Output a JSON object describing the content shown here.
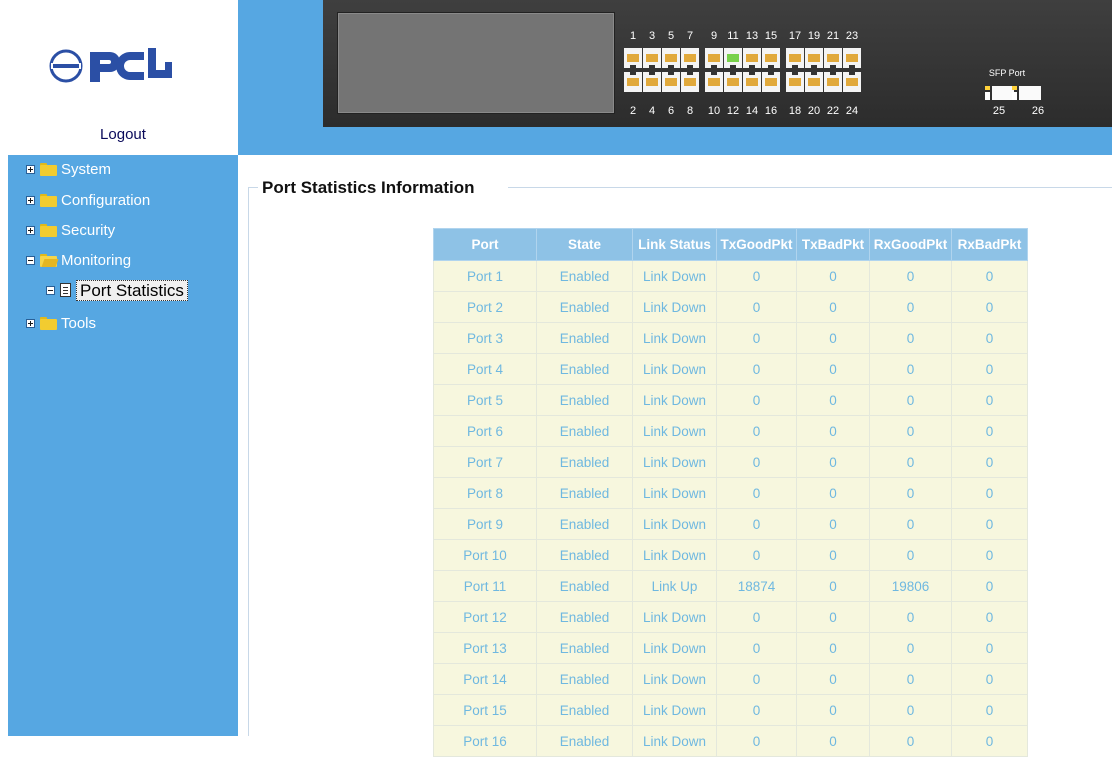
{
  "header": {
    "logo_text": "PCi",
    "logout_label": "Logout"
  },
  "nav": {
    "items": [
      {
        "label": "System",
        "expanded": false
      },
      {
        "label": "Configuration",
        "expanded": false
      },
      {
        "label": "Security",
        "expanded": false
      },
      {
        "label": "Monitoring",
        "expanded": true
      },
      {
        "label": "Port Statistics",
        "selected": true
      },
      {
        "label": "Tools",
        "expanded": false
      }
    ]
  },
  "device": {
    "top_port_numbers": [
      "1",
      "3",
      "5",
      "7",
      "9",
      "11",
      "13",
      "15",
      "17",
      "19",
      "21",
      "23"
    ],
    "bottom_port_numbers": [
      "2",
      "4",
      "6",
      "8",
      "10",
      "12",
      "14",
      "16",
      "18",
      "20",
      "22",
      "24"
    ],
    "sfp_label": "SFP Port",
    "sfp_ports": [
      "25",
      "26"
    ],
    "link_up_port": "11"
  },
  "main": {
    "title": "Port Statistics Information",
    "table": {
      "headers": [
        "Port",
        "State",
        "Link Status",
        "TxGoodPkt",
        "TxBadPkt",
        "RxGoodPkt",
        "RxBadPkt"
      ],
      "rows": [
        [
          "Port 1",
          "Enabled",
          "Link Down",
          "0",
          "0",
          "0",
          "0"
        ],
        [
          "Port 2",
          "Enabled",
          "Link Down",
          "0",
          "0",
          "0",
          "0"
        ],
        [
          "Port 3",
          "Enabled",
          "Link Down",
          "0",
          "0",
          "0",
          "0"
        ],
        [
          "Port 4",
          "Enabled",
          "Link Down",
          "0",
          "0",
          "0",
          "0"
        ],
        [
          "Port 5",
          "Enabled",
          "Link Down",
          "0",
          "0",
          "0",
          "0"
        ],
        [
          "Port 6",
          "Enabled",
          "Link Down",
          "0",
          "0",
          "0",
          "0"
        ],
        [
          "Port 7",
          "Enabled",
          "Link Down",
          "0",
          "0",
          "0",
          "0"
        ],
        [
          "Port 8",
          "Enabled",
          "Link Down",
          "0",
          "0",
          "0",
          "0"
        ],
        [
          "Port 9",
          "Enabled",
          "Link Down",
          "0",
          "0",
          "0",
          "0"
        ],
        [
          "Port 10",
          "Enabled",
          "Link Down",
          "0",
          "0",
          "0",
          "0"
        ],
        [
          "Port 11",
          "Enabled",
          "Link Up",
          "18874",
          "0",
          "19806",
          "0"
        ],
        [
          "Port 12",
          "Enabled",
          "Link Down",
          "0",
          "0",
          "0",
          "0"
        ],
        [
          "Port 13",
          "Enabled",
          "Link Down",
          "0",
          "0",
          "0",
          "0"
        ],
        [
          "Port 14",
          "Enabled",
          "Link Down",
          "0",
          "0",
          "0",
          "0"
        ],
        [
          "Port 15",
          "Enabled",
          "Link Down",
          "0",
          "0",
          "0",
          "0"
        ],
        [
          "Port 16",
          "Enabled",
          "Link Down",
          "0",
          "0",
          "0",
          "0"
        ]
      ]
    }
  },
  "colors": {
    "sidebar_bg": "#56a7e2",
    "table_header_bg": "#8ec2e6",
    "table_cell_bg": "#f7f7de",
    "table_text": "#6fb8e0",
    "port_jack": "#e1a93b",
    "port_link_up": "#78d14a"
  }
}
